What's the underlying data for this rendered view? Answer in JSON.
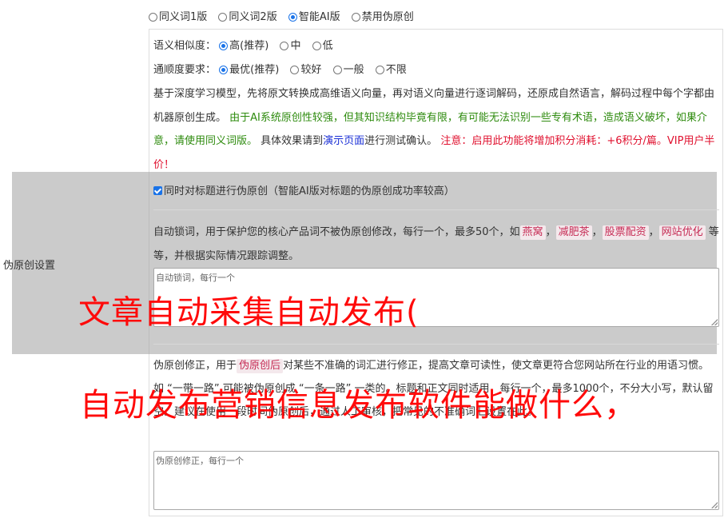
{
  "modes": [
    {
      "label": "同义词1版",
      "checked": false
    },
    {
      "label": "同义词2版",
      "checked": false
    },
    {
      "label": "智能AI版",
      "checked": true
    },
    {
      "label": "禁用伪原创",
      "checked": false
    }
  ],
  "similarity": {
    "label": "语义相似度：",
    "options": [
      {
        "label": "高(推荐)",
        "checked": true
      },
      {
        "label": "中",
        "checked": false
      },
      {
        "label": "低",
        "checked": false
      }
    ]
  },
  "fluency": {
    "label": "通顺度要求：",
    "options": [
      {
        "label": "最优(推荐)",
        "checked": true
      },
      {
        "label": "较好",
        "checked": false
      },
      {
        "label": "一般",
        "checked": false
      },
      {
        "label": "不限",
        "checked": false
      }
    ]
  },
  "description": {
    "part1": "基于深度学习模型，先将原文转换成高维语义向量，再对语义向量进行逐词解码，还原成自然语言，解码过程中每个字都由机器原创生成。 ",
    "green": "由于AI系统原创性较强，但其知识结构毕竟有限，有可能无法识别一些专有术语，造成语义破坏，如果介意，请使用同义词版。",
    "part2": " 具体效果请到",
    "link": "演示页面",
    "part3": "进行测试确认。 ",
    "red": "注意：启用此功能将增加积分消耗：+6积分/篇。VIP用户半价！"
  },
  "side_label": "伪原创设置",
  "title_check": "同时对标题进行伪原创（智能AI版对标题的伪原创成功率较高）",
  "lock": {
    "prefix": "自动锁词，用于保护您的核心产品词不被伪原创修改，每行一个，最多50个，如",
    "tags": [
      "燕窝",
      "减肥茶",
      "股票配资",
      "网站优化"
    ],
    "sep": "，",
    "suffix": "等等，并根据实际情况跟踪调整。",
    "placeholder": "自动锁词，每行一个"
  },
  "fix": {
    "prefix": "伪原创修正，用于",
    "tag": "伪原创后",
    "text": "对某些不准确的词汇进行修正，提高文章可读性，使文章更符合您网站所在行业的用语习惯。如 “一带一路” 可能被伪原创成 “一条一路” 一类的。标题和正文同时适用，每行一个，最多1000个，不分大小写，默认留空。建议在使用一段时间伪原创后，通过人工审核，把常见的不准确词汇设置在此。",
    "placeholder": "伪原创修正，每行一个"
  },
  "watermark": {
    "line1": "文章自动采集自动发布(",
    "line2": "自动发布营销信息发布软件能做什么，"
  }
}
